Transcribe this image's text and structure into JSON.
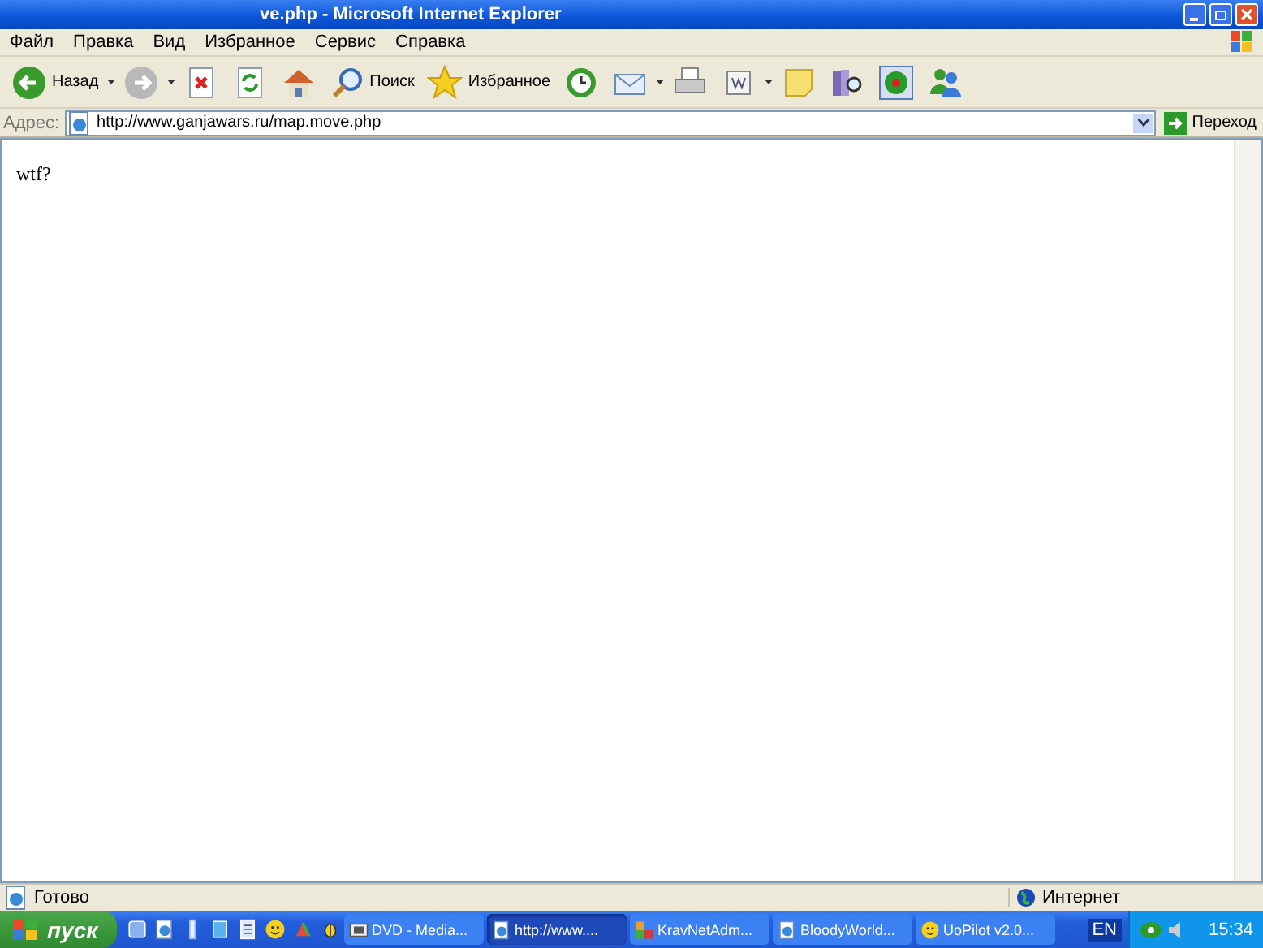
{
  "window": {
    "title": "ve.php - Microsoft Internet Explorer"
  },
  "menu": [
    {
      "label": "Файл"
    },
    {
      "label": "Правка"
    },
    {
      "label": "Вид"
    },
    {
      "label": "Избранное"
    },
    {
      "label": "Сервис"
    },
    {
      "label": "Справка"
    }
  ],
  "toolbar": [
    {
      "kind": "back",
      "label": "Назад",
      "dropdown": true
    },
    {
      "kind": "forward",
      "dropdown": true
    },
    {
      "kind": "stop"
    },
    {
      "kind": "refresh"
    },
    {
      "kind": "home"
    },
    {
      "kind": "search",
      "label": "Поиск"
    },
    {
      "kind": "favorites",
      "label": "Избранное"
    },
    {
      "kind": "history"
    },
    {
      "kind": "mail",
      "dropdown": true
    },
    {
      "kind": "print"
    },
    {
      "kind": "edit",
      "dropdown": true
    },
    {
      "kind": "note"
    },
    {
      "kind": "research"
    },
    {
      "kind": "flower"
    },
    {
      "kind": "messenger"
    }
  ],
  "address": {
    "label": "Адрес:",
    "value": "http://www.ganjawars.ru/map.move.php",
    "go": "Переход"
  },
  "page": {
    "text": "wtf?"
  },
  "status": {
    "text": "Готово",
    "zone": "Интернет"
  },
  "taskbar": {
    "start": "пуск",
    "quick_launch": [
      {
        "kind": "blue"
      },
      {
        "kind": "ie"
      },
      {
        "kind": "phone"
      },
      {
        "kind": "doc"
      },
      {
        "kind": "list"
      },
      {
        "kind": "smiley"
      },
      {
        "kind": "paint"
      },
      {
        "kind": "bug"
      }
    ],
    "tasks": [
      {
        "label": "DVD - Media...",
        "kind": "media",
        "selected": false
      },
      {
        "label": "http://www....",
        "kind": "ie",
        "selected": true
      },
      {
        "label": "KravNetAdm...",
        "kind": "app",
        "selected": false
      },
      {
        "label": "BloodyWorld...",
        "kind": "ie",
        "selected": false
      },
      {
        "label": "UoPilot  v2.0...",
        "kind": "smiley",
        "selected": false
      }
    ],
    "language": "EN",
    "clock": "15:34"
  }
}
